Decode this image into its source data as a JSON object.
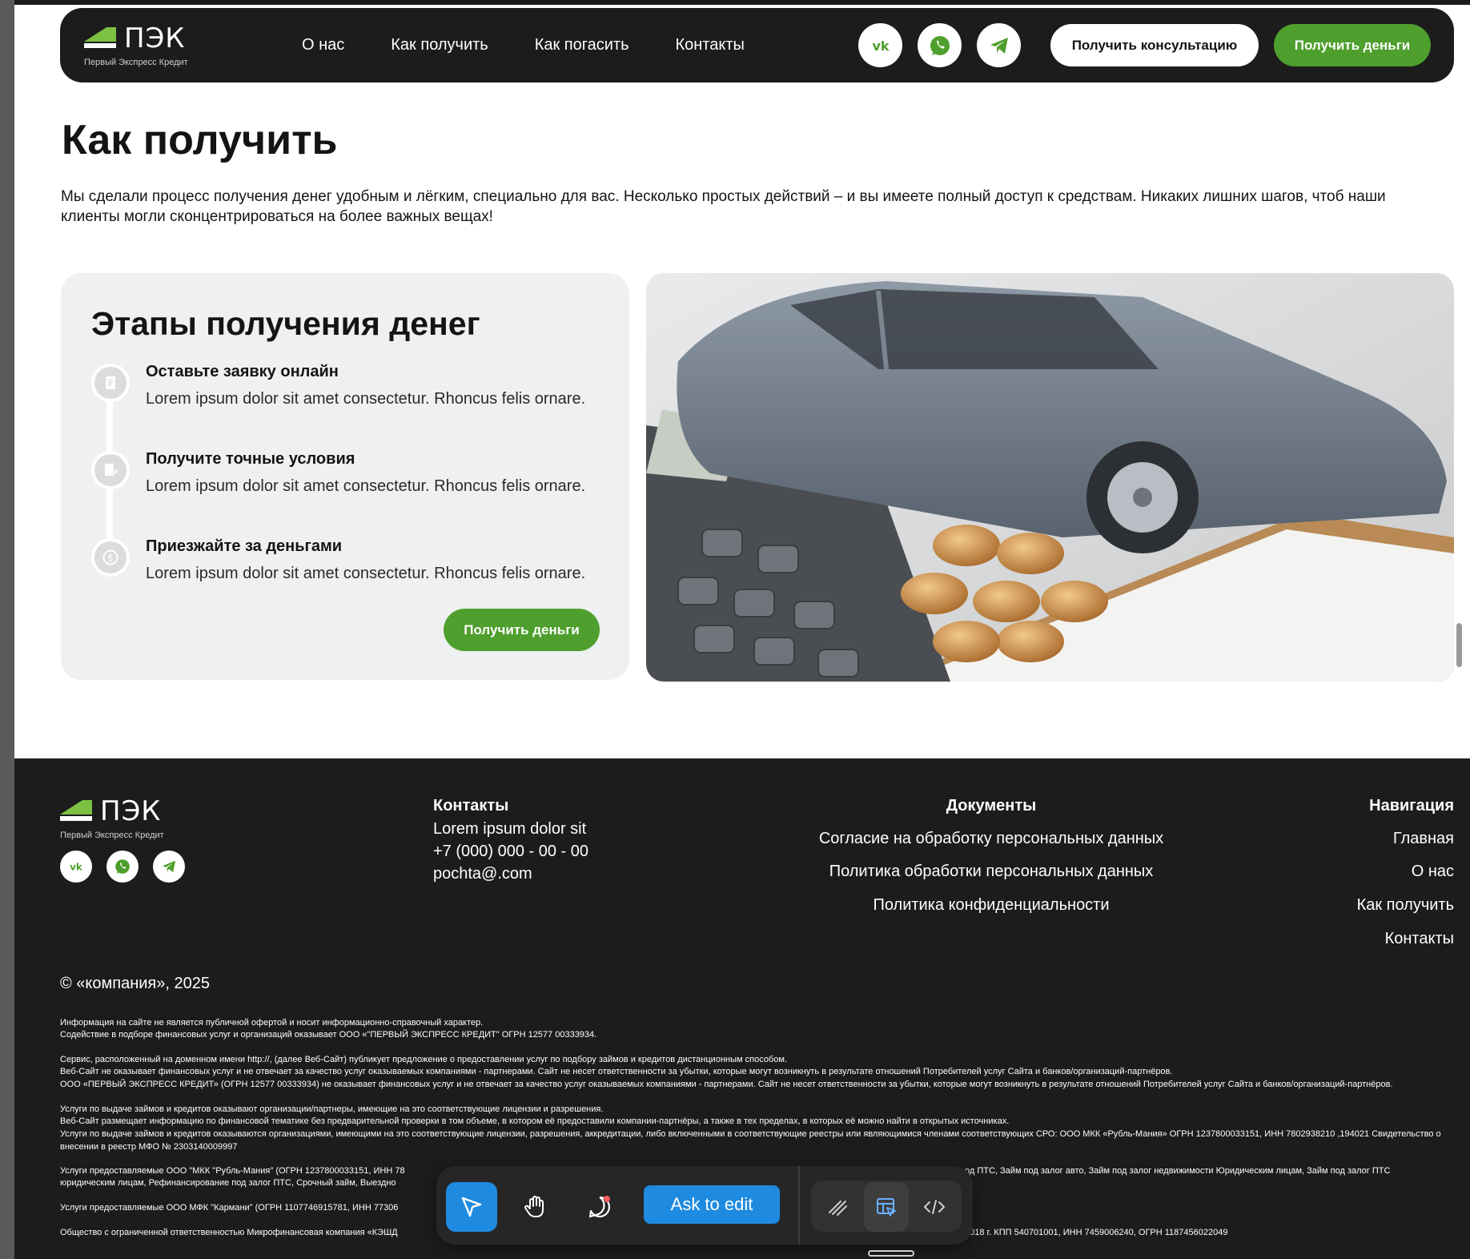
{
  "brand": {
    "name": "ПЭК",
    "tagline": "Первый Экспресс Кредит",
    "accent_color": "#4e9f2d",
    "dark_color": "#1c1c1c"
  },
  "header": {
    "nav": [
      "О нас",
      "Как получить",
      "Как погасить",
      "Контакты"
    ],
    "social_icons": [
      "vk-icon",
      "whatsapp-icon",
      "telegram-icon"
    ],
    "consult_button": "Получить консультацию",
    "money_button": "Получить деньги"
  },
  "main": {
    "title": "Как получить",
    "intro": "Мы сделали процесс получения денег удобным и лёгким, специально для вас. Несколько простых действий – и вы имеете полный доступ к средствам. Никаких лишних шагов, чтоб наши клиенты могли сконцентрироваться на более важных вещах!",
    "steps_card": {
      "title": "Этапы получения денег",
      "steps": [
        {
          "icon": "document-icon",
          "title": "Оставьте заявку онлайн",
          "text": "Lorem ipsum dolor sit amet consectetur. Rhoncus felis ornare."
        },
        {
          "icon": "edit-document-icon",
          "title": "Получите точные условия",
          "text": "Lorem ipsum dolor sit amet consectetur. Rhoncus felis ornare."
        },
        {
          "icon": "dollar-coin-icon",
          "title": "Приезжайте за деньгами",
          "text": "Lorem ipsum dolor sit amet consectetur. Rhoncus felis ornare."
        }
      ],
      "button": "Получить деньги"
    },
    "photo_alt": "car-calculator-coins-photo"
  },
  "footer": {
    "contacts": {
      "heading": "Контакты",
      "address": "Lorem ipsum dolor sit",
      "phone": "+7 (000) 000 - 00 - 00",
      "email": "pochta@.com"
    },
    "documents": {
      "heading": "Документы",
      "links": [
        "Согласие на обработку персональных данных",
        "Политика обработки персональных данных",
        "Политика конфиденциальности"
      ]
    },
    "navigation": {
      "heading": "Навигация",
      "links": [
        "Главная",
        "О нас",
        "Как получить",
        "Контакты"
      ]
    },
    "copyright": "©  «компания», 2025",
    "legal": [
      "Информация на сайте не является публичной офертой и носит информационно-справочный характер.",
      "Содействие в подборе финансовых услуг и организаций оказывает ООО «\"ПЕРВЫЙ ЭКСПРЕСС КРЕДИТ\" ОГРН 12577 00333934.",
      "Сервис, расположенный на доменном имени http://, (далее Веб-Сайт) публикует предложение о предоставлении услуг по подбору займов и кредитов дистанционным способом.",
      "Веб-Сайт не оказывает финансовых услуг и не отвечает за качество услуг оказываемых компаниями - партнерами. Сайт не несет ответственности за убытки, которые могут возникнуть в результате отношений Потребителей услуг Сайта и банков/организаций-партнёров.",
      "ООО «ПЕРВЫЙ ЭКСПРЕСС КРЕДИТ» (ОГРН 12577 00333934) не оказывает финансовых услуг и не отвечает за качество услуг оказываемых компаниями - партнерами. Сайт не несет ответственности за убытки, которые могут возникнуть в результате отношений Потребителей услуг Сайта и банков/организаций-партнёров.",
      "Услуги по выдаче займов и кредитов оказывают организации/партнеры, имеющие на это соответствующие лицензии и разрешения.",
      "Веб-Сайт размещает информацию по финансовой тематике без предварительной проверки в том объеме, в котором её предоставили компании-партнёры, а также в тех пределах, в которых её можно найти в открытых источниках.",
      "Услуги по выдаче займов и кредитов оказываются организациями, имеющими на это соответствующие лицензии, разрешения, аккредитации, либо включенными в соответствующие реестры или являющимися членами соответствующих СРО: ООО МКК «Рубль-Мания» ОГРН 1237800033151, ИНН 7802938210 ,194021 Свидетельство о внесении в реестр МФО № 2303140009997",
      "Услуги предоставляемые ООО \"МКК \"Рубль-Мания\" (ОГРН 1237800033151, ИНН 78",
      "од ПТС, Займ под залог авто, Займ под залог недвижимости Юридическим лицам, Займ под залог ПТС",
      "юридическим лицам, Рефинансирование под залог ПТС, Срочный займ, Выездно",
      "Услуги предоставляемые ООО МФК \"Кармани\" (ОГРН 1107746915781, ИНН 77306",
      "Общество с ограниченной ответственностью Микрофинансовая компания «КЭШД",
      "2018 г. КПП 540701001, ИНН 7459006240, ОГРН 1187456022049"
    ]
  },
  "toolbar": {
    "ask_label": "Ask to edit",
    "tools": [
      "cursor-icon",
      "hand-icon",
      "comment-icon",
      "draw-icon",
      "layout-select-icon",
      "code-icon"
    ],
    "active_color": "#1e8ae0"
  }
}
